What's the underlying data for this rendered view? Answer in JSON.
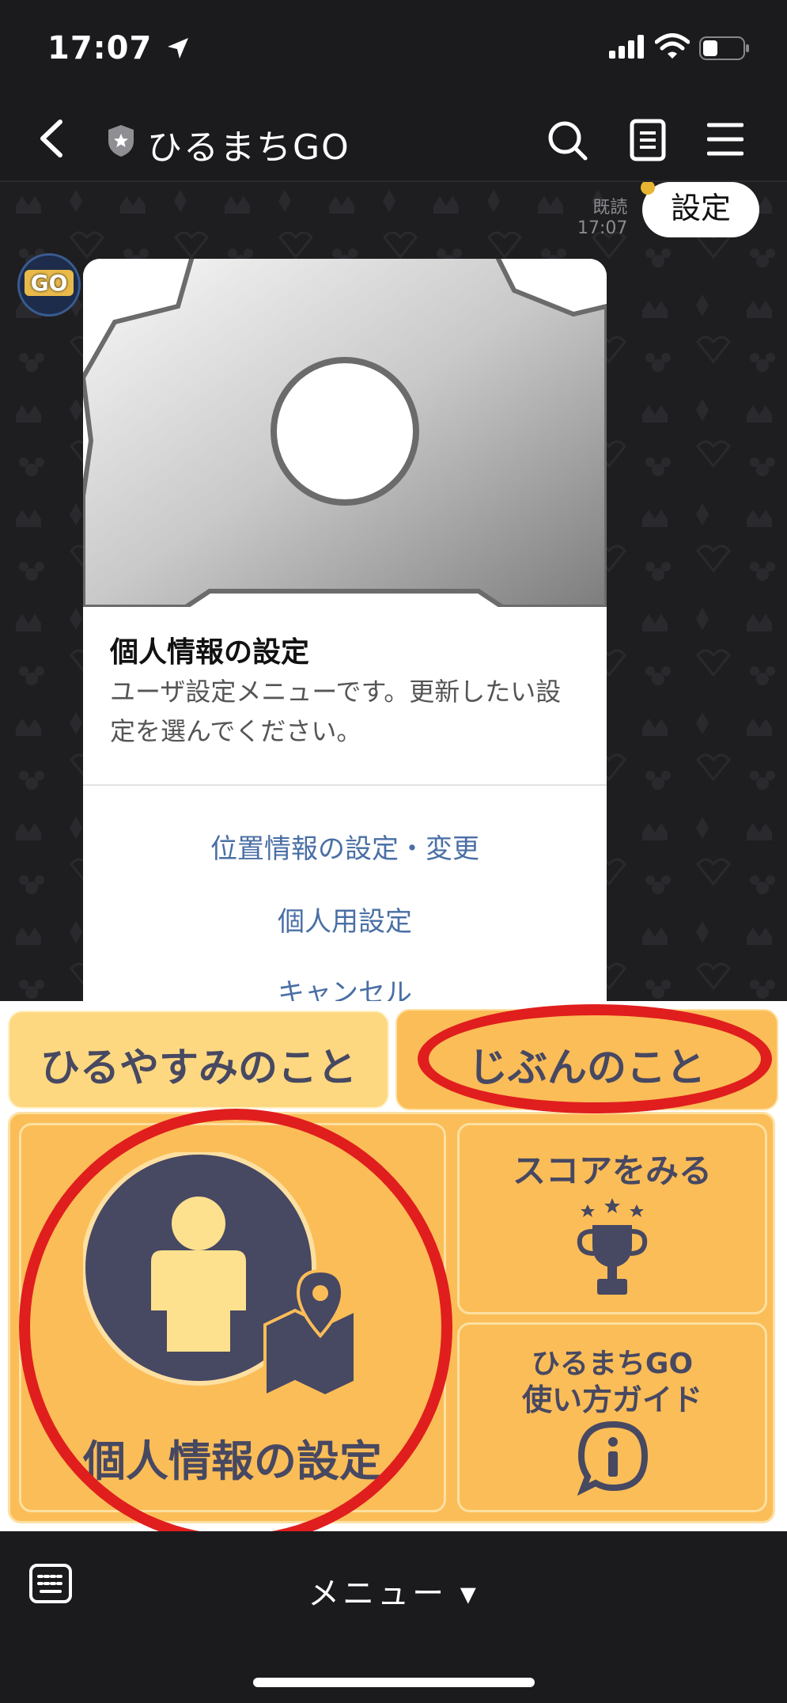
{
  "status": {
    "time": "17:07"
  },
  "nav": {
    "title": "ひるまちGO",
    "icons": [
      "back-icon",
      "shield-icon",
      "search-icon",
      "notes-icon",
      "hamburger-icon"
    ]
  },
  "chat": {
    "read_label": "既読",
    "read_time": "17:07",
    "user_bubble": "設定",
    "bot_avatar_text": "GO",
    "card": {
      "title": "個人情報の設定",
      "description": "ユーザ設定メニューです。更新したい設定を選んでください。",
      "actions": [
        "位置情報の設定・変更",
        "個人用設定",
        "キャンセル"
      ]
    }
  },
  "rich_menu": {
    "tabs": [
      "ひるやすみのこと",
      "じぶんのこと"
    ],
    "active_tab": "じぶんのこと",
    "buttons": {
      "personal_settings": "個人情報の設定",
      "view_score": "スコアをみる",
      "guide_line1": "ひるまちGO",
      "guide_line2": "使い方ガイド"
    },
    "colors": {
      "panel": "#fbbd57",
      "panel_border": "#fde0a1",
      "icon_dark": "#474862",
      "highlight_ring": "#e01e1e"
    }
  },
  "bottom": {
    "menu_label": "メニュー ▾"
  }
}
